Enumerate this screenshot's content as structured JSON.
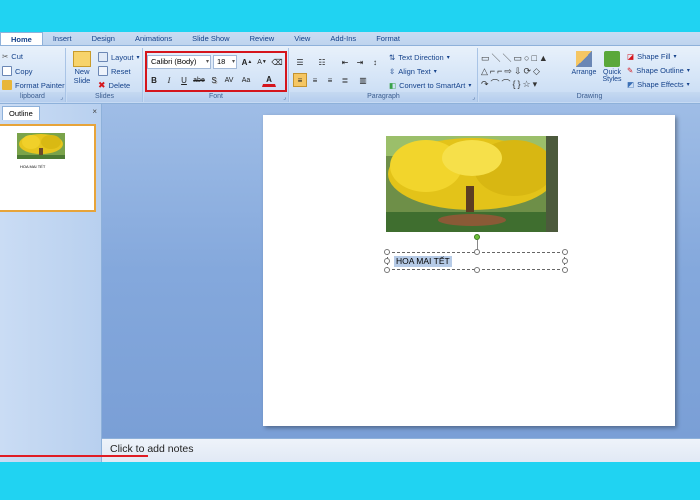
{
  "tabs": [
    "Home",
    "Insert",
    "Design",
    "Animations",
    "Slide Show",
    "Review",
    "View",
    "Add-Ins",
    "Format"
  ],
  "clipboard": {
    "cut": "Cut",
    "copy": "Copy",
    "format_painter": "Format Painter",
    "label": "lipboard"
  },
  "slides_group": {
    "new_slide_1": "New",
    "new_slide_2": "Slide",
    "layout": "Layout",
    "reset": "Reset",
    "delete": "Delete",
    "label": "Slides"
  },
  "font": {
    "family": "Calibri (Body)",
    "size": "18",
    "grow": "A",
    "shrink": "A",
    "bold": "B",
    "italic": "I",
    "underline": "U",
    "strike": "abe",
    "shadow": "S",
    "spacing": "AV",
    "case": "Aa",
    "color": "A",
    "label": "Font"
  },
  "paragraph": {
    "text_direction": "Text Direction",
    "align_text": "Align Text",
    "convert_smartart": "Convert to SmartArt",
    "label": "Paragraph"
  },
  "drawing": {
    "arrange": "Arrange",
    "quick_styles_1": "Quick",
    "quick_styles_2": "Styles",
    "shape_fill": "Shape Fill",
    "shape_outline": "Shape Outline",
    "shape_effects": "Shape Effects",
    "label": "Drawing"
  },
  "sidebar": {
    "tab": "Outline",
    "close": "×",
    "thumb_title": "HOA MAI TẾT"
  },
  "slide": {
    "title": "HOA MAI TẾT"
  },
  "notes": {
    "placeholder": "Click to add notes"
  },
  "colors": {
    "accent_red": "#d5151c",
    "background_cyan": "#20d3f2",
    "ribbon_text": "#15428b"
  }
}
